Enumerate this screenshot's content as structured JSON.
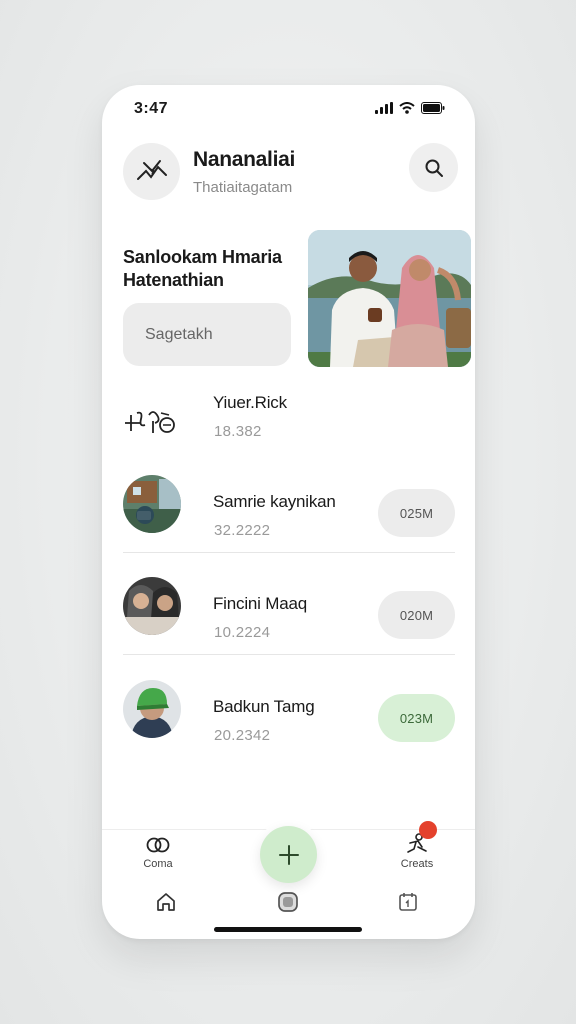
{
  "status_bar": {
    "time": "3:47"
  },
  "header": {
    "title": "Nananaliai",
    "subtitle": "Thatiaitagatam"
  },
  "hero": {
    "line1": "Sanlookam Hmaria",
    "line2": "Hatenathian",
    "input_value": "Sagetakh"
  },
  "list": [
    {
      "name": "Yiuer.Rick",
      "number": "18.382"
    },
    {
      "name": "Samrie kaynikan",
      "number": "32.2222",
      "pill": "025M"
    },
    {
      "name": "Fincini Maaq",
      "number": "10.2224",
      "pill": "020M"
    },
    {
      "name": "Badkun Tamg",
      "number": "20.2342",
      "pill": "023M"
    }
  ],
  "nav": {
    "left_label": "Coma",
    "right_label": "Creats"
  },
  "colors": {
    "accent_green": "#cfeccc",
    "badge_red": "#e4412c"
  },
  "icons": [
    "signal-icon",
    "wifi-icon",
    "battery-icon",
    "search-icon",
    "plus-icon",
    "home-icon",
    "square-icon",
    "calendar-icon"
  ]
}
